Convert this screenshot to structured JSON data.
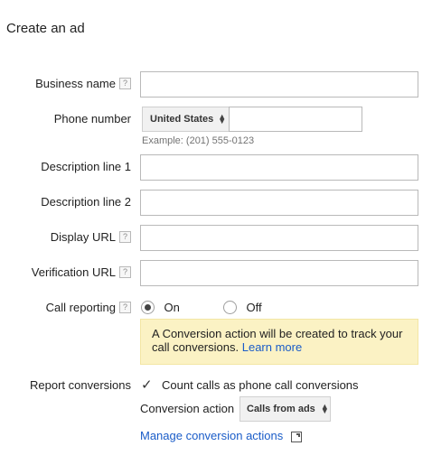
{
  "page": {
    "title": "Create an ad"
  },
  "fields": {
    "business_name": {
      "label": "Business name",
      "help": "?",
      "value": ""
    },
    "phone_number": {
      "label": "Phone number",
      "country": "United States",
      "value": "",
      "hint": "Example: (201) 555-0123"
    },
    "description_1": {
      "label": "Description line 1",
      "value": ""
    },
    "description_2": {
      "label": "Description line 2",
      "value": ""
    },
    "display_url": {
      "label": "Display URL",
      "help": "?",
      "value": ""
    },
    "verification_url": {
      "label": "Verification URL",
      "help": "?",
      "value": ""
    }
  },
  "call_reporting": {
    "label": "Call reporting",
    "help": "?",
    "options": [
      {
        "label": "On",
        "checked": true
      },
      {
        "label": "Off",
        "checked": false
      }
    ],
    "notice_text": "A Conversion action will be created to track your call conversions.",
    "notice_link": "Learn more"
  },
  "report_conversions": {
    "label": "Report conversions",
    "checkbox_label": "Count calls as phone call conversions",
    "checked": true,
    "action_label": "Conversion action",
    "action_value": "Calls from ads",
    "manage_link": "Manage conversion actions"
  },
  "icons": {
    "checkmark": "✓",
    "updown": "▲▼",
    "external": "external-link-icon"
  }
}
